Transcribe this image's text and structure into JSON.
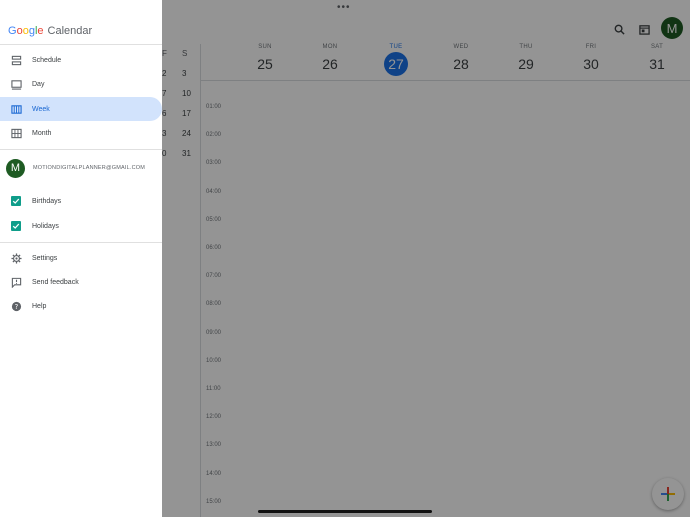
{
  "drawer": {
    "brand": {
      "google_letters": [
        "G",
        "o",
        "o",
        "g",
        "l",
        "e"
      ],
      "product": "Calendar"
    },
    "views": [
      {
        "label": "Schedule",
        "icon": "schedule-icon",
        "selected": false
      },
      {
        "label": "Day",
        "icon": "day-view-icon",
        "selected": false
      },
      {
        "label": "Week",
        "icon": "week-view-icon",
        "selected": true
      },
      {
        "label": "Month",
        "icon": "month-view-icon",
        "selected": false
      }
    ],
    "account": {
      "avatar_letter": "M",
      "email": "MOTIONDIGITALPLANNER@GMAIL.COM"
    },
    "calendars": [
      {
        "label": "Birthdays",
        "checked": true
      },
      {
        "label": "Holidays",
        "checked": true
      }
    ],
    "bottom": [
      {
        "label": "Settings",
        "icon": "gear-icon"
      },
      {
        "label": "Send feedback",
        "icon": "feedback-icon"
      },
      {
        "label": "Help",
        "icon": "help-icon"
      }
    ]
  },
  "calendar": {
    "avatar_letter": "M",
    "minical": {
      "headers": [
        "F",
        "S"
      ],
      "rows": [
        [
          "2",
          "3"
        ],
        [
          "7",
          "10"
        ],
        [
          "6",
          "17"
        ],
        [
          "3",
          "24"
        ],
        [
          "0",
          "31"
        ]
      ]
    },
    "days": [
      {
        "name": "SUN",
        "date": "25",
        "today": false
      },
      {
        "name": "MON",
        "date": "26",
        "today": false
      },
      {
        "name": "TUE",
        "date": "27",
        "today": true
      },
      {
        "name": "WED",
        "date": "28",
        "today": false
      },
      {
        "name": "THU",
        "date": "29",
        "today": false
      },
      {
        "name": "FRI",
        "date": "30",
        "today": false
      },
      {
        "name": "SAT",
        "date": "31",
        "today": false
      }
    ],
    "hours": [
      "01:00",
      "02:00",
      "03:00",
      "04:00",
      "05:00",
      "06:00",
      "07:00",
      "08:00",
      "09:00",
      "10:00",
      "11:00",
      "12:00",
      "13:00",
      "14:00",
      "15:00"
    ]
  },
  "colors": {
    "accent": "#1a73e8",
    "selected_bg": "#d2e3fc",
    "avatar": "#1e5b23",
    "checkbox": "#0f9d8a"
  }
}
